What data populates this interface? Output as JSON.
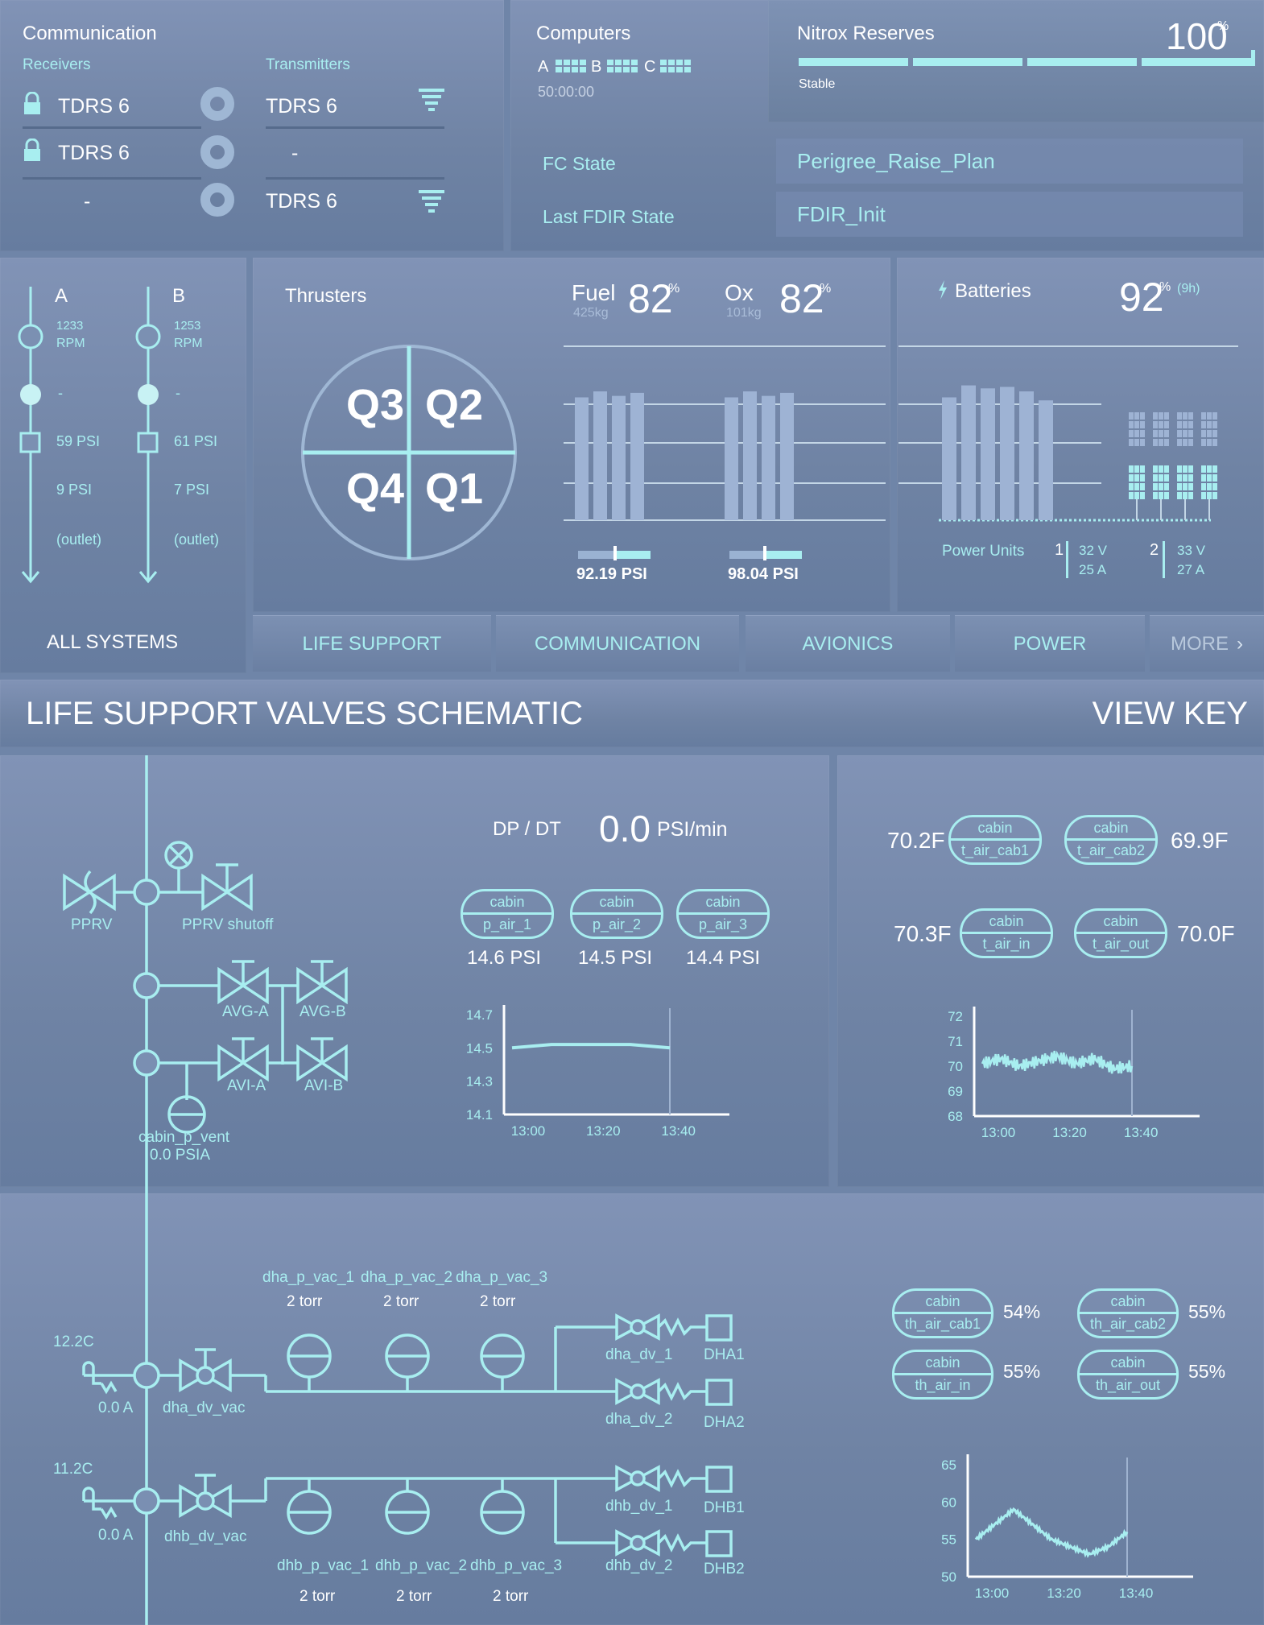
{
  "colors": {
    "accent": "#a8eef0",
    "bg": "#6f85a8",
    "text": "#ffffff"
  },
  "communication": {
    "title": "Communication",
    "receivers_label": "Receivers",
    "transmitters_label": "Transmitters",
    "receivers": [
      "TDRS 6",
      "TDRS 6",
      "-"
    ],
    "transmitters": [
      "TDRS 6",
      "-",
      "TDRS 6"
    ]
  },
  "computers": {
    "title": "Computers",
    "a": "A",
    "b": "B",
    "c": "C",
    "time": "50:00:00",
    "fc_state_label": "FC State",
    "fc_state": "Perigree_Raise_Plan",
    "fdir_label": "Last FDIR State",
    "fdir": "FDIR_Init"
  },
  "nitrox": {
    "title": "Nitrox Reserves",
    "value": "100",
    "unit": "%",
    "status": "Stable",
    "level": 1.0
  },
  "pumps": {
    "a": {
      "label": "A",
      "rpm": "1233",
      "rpm_unit": "RPM",
      "dash": "-",
      "psi_in": "59 PSI",
      "psi_out": "9 PSI",
      "outlet": "(outlet)"
    },
    "b": {
      "label": "B",
      "rpm": "1253",
      "rpm_unit": "RPM",
      "dash": "-",
      "psi_in": "61 PSI",
      "psi_out": "7 PSI",
      "outlet": "(outlet)"
    }
  },
  "thrusters": {
    "title": "Thrusters",
    "quadrants": [
      "Q3",
      "Q2",
      "Q4",
      "Q1"
    ],
    "fuel_label": "Fuel",
    "fuel_mass": "425kg",
    "fuel_pct": "82",
    "pct": "%",
    "ox_label": "Ox",
    "ox_mass": "101kg",
    "ox_pct": "82",
    "fuel_psi": "92.19 PSI",
    "ox_psi": "98.04 PSI",
    "fuel_bars": [
      0.82,
      0.86,
      0.83,
      0.85
    ],
    "ox_bars": [
      0.82,
      0.86,
      0.83,
      0.85
    ]
  },
  "batteries": {
    "title": "Batteries",
    "value": "92",
    "unit": "%",
    "duration": "(9h)",
    "bars": [
      0.82,
      0.9,
      0.88,
      0.89,
      0.86,
      0.8
    ],
    "power_units_label": "Power Units",
    "unit1": {
      "id": "1",
      "v": "32 V",
      "a": "25 A"
    },
    "unit2": {
      "id": "2",
      "v": "33 V",
      "a": "27 A"
    }
  },
  "tabs": {
    "all": "ALL SYSTEMS",
    "life": "LIFE SUPPORT",
    "comm": "COMMUNICATION",
    "avionics": "AVIONICS",
    "power": "POWER",
    "more": "MORE"
  },
  "schematic": {
    "title": "LIFE SUPPORT VALVES SCHEMATIC",
    "view_key": "VIEW KEY",
    "pprv": "PPRV",
    "pprv_shutoff": "PPRV shutoff",
    "avg_a": "AVG-A",
    "avg_b": "AVG-B",
    "avi_a": "AVI-A",
    "avi_b": "AVI-B",
    "cabin_vent": "cabin_p_vent",
    "cabin_vent_val": "0.0 PSIA",
    "dpdt_label": "DP / DT",
    "dpdt_value": "0.0",
    "dpdt_unit": "PSI/min",
    "pressure_tags": [
      {
        "top": "cabin",
        "bottom": "p_air_1",
        "value": "14.6 PSI"
      },
      {
        "top": "cabin",
        "bottom": "p_air_2",
        "value": "14.5 PSI"
      },
      {
        "top": "cabin",
        "bottom": "p_air_3",
        "value": "14.4 PSI"
      }
    ],
    "temp_tags": [
      {
        "top": "cabin",
        "bottom": "t_air_cab1",
        "value": "70.2F"
      },
      {
        "top": "cabin",
        "bottom": "t_air_cab2",
        "value": "69.9F"
      },
      {
        "top": "cabin",
        "bottom": "t_air_in",
        "value": "70.3F"
      },
      {
        "top": "cabin",
        "bottom": "t_air_out",
        "value": "70.0F"
      }
    ],
    "humid_tags": [
      {
        "top": "cabin",
        "bottom": "th_air_cab1",
        "value": "54%"
      },
      {
        "top": "cabin",
        "bottom": "th_air_cab2",
        "value": "55%"
      },
      {
        "top": "cabin",
        "bottom": "th_air_in",
        "value": "55%"
      },
      {
        "top": "cabin",
        "bottom": "th_air_out",
        "value": "55%"
      }
    ],
    "dha": {
      "temp": "12.2C",
      "current": "0.0 A",
      "valve": "dha_dv_vac",
      "vac": [
        "dha_p_vac_1",
        "dha_p_vac_2",
        "dha_p_vac_3"
      ],
      "vac_val": [
        "2 torr",
        "2 torr",
        "2 torr"
      ],
      "dv1": "dha_dv_1",
      "dv2": "dha_dv_2",
      "out1": "DHA1",
      "out2": "DHA2"
    },
    "dhb": {
      "temp": "11.2C",
      "current": "0.0 A",
      "valve": "dhb_dv_vac",
      "vac": [
        "dhb_p_vac_1",
        "dhb_p_vac_2",
        "dhb_p_vac_3"
      ],
      "vac_val": [
        "2 torr",
        "2 torr",
        "2 torr"
      ],
      "dv1": "dhb_dv_1",
      "dv2": "dhb_dv_2",
      "out1": "DHB1",
      "out2": "DHB2"
    }
  },
  "chart_data": [
    {
      "type": "line",
      "yticks": [
        "14.7",
        "14.5",
        "14.3",
        "14.1"
      ],
      "xticks": [
        "13:00",
        "13:20",
        "13:40"
      ],
      "ylim": [
        14.1,
        14.7
      ],
      "x": [
        "13:00",
        "13:10",
        "13:20",
        "13:30",
        "13:40"
      ],
      "y": [
        14.5,
        14.52,
        14.52,
        14.52,
        14.5
      ]
    },
    {
      "type": "line",
      "yticks": [
        "72",
        "71",
        "70",
        "69",
        "68"
      ],
      "xticks": [
        "13:00",
        "13:20",
        "13:40"
      ],
      "ylim": [
        68,
        72
      ],
      "x": [
        "13:00",
        "13:05",
        "13:10",
        "13:15",
        "13:20",
        "13:25",
        "13:30",
        "13:35",
        "13:40"
      ],
      "y": [
        70.1,
        70.3,
        70.0,
        70.2,
        70.4,
        70.1,
        70.3,
        69.9,
        70.0
      ]
    },
    {
      "type": "line",
      "yticks": [
        "65",
        "60",
        "55",
        "50"
      ],
      "xticks": [
        "13:00",
        "13:20",
        "13:40"
      ],
      "ylim": [
        50,
        65
      ],
      "x": [
        "13:00",
        "13:05",
        "13:10",
        "13:15",
        "13:20",
        "13:25",
        "13:30",
        "13:35",
        "13:40"
      ],
      "y": [
        55,
        57,
        59,
        57,
        55,
        54,
        53,
        54,
        56
      ]
    }
  ]
}
